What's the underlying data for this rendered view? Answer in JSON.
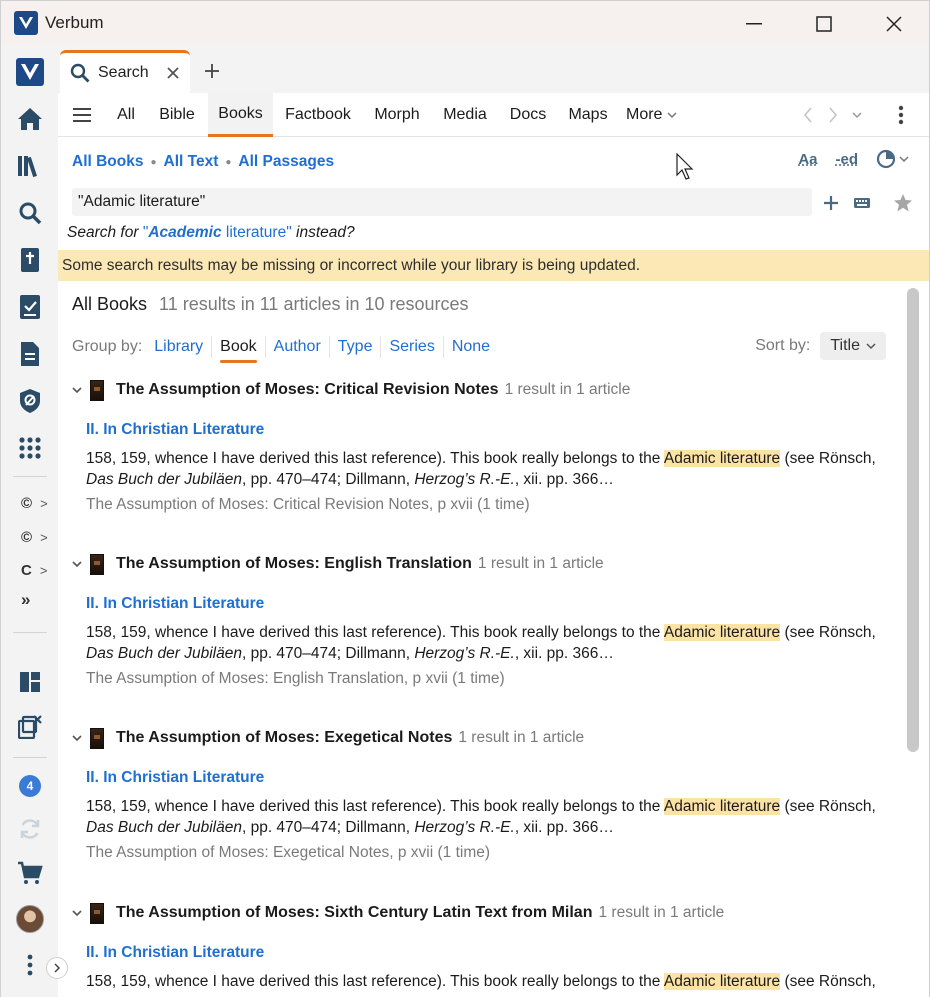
{
  "window": {
    "title": "Verbum",
    "controls": [
      "minimize",
      "maximize",
      "close"
    ]
  },
  "tab": {
    "label": "Search"
  },
  "nav": {
    "tabs": [
      {
        "label": "All"
      },
      {
        "label": "Bible"
      },
      {
        "label": "Books"
      },
      {
        "label": "Factbook"
      },
      {
        "label": "Morph"
      },
      {
        "label": "Media"
      },
      {
        "label": "Docs"
      },
      {
        "label": "Maps"
      },
      {
        "label": "More"
      }
    ],
    "active": "Books"
  },
  "scope": {
    "a": "All Books",
    "b": "All Text",
    "c": "All Passages"
  },
  "toolbar_icons": {
    "font": "Aa",
    "inflect": "-ed"
  },
  "search": {
    "value": "\"Adamic literature\""
  },
  "suggestion": {
    "prefix": "Search for",
    "quote_open": "\"",
    "bold_word": "Academic",
    "rest": " literature\"",
    "suffix": "instead?"
  },
  "warning": "Some search results may be missing or incorrect while your library is being updated.",
  "results": {
    "title": "All Books",
    "count": "11 results in 11 articles in 10 resources"
  },
  "group_by": {
    "label": "Group by:",
    "options": [
      "Library",
      "Book",
      "Author",
      "Type",
      "Series",
      "None"
    ],
    "active": "Book"
  },
  "sort_by": {
    "label": "Sort by:",
    "value": "Title"
  },
  "rail": {
    "small_items": [
      "©",
      "©",
      "C"
    ],
    "badge": "4"
  },
  "groups": [
    {
      "title": "The Assumption of Moses: Critical Revision Notes",
      "count": "1 result in 1 article",
      "article": "II. In Christian Literature",
      "pre": "158, 159, whence I have derived this last reference). This book really belongs to the ",
      "hit": "Adamic literature",
      "post1": " (see Rönsch,",
      "i1": "Das Buch der Jubiläen",
      "m1": ", pp. 470–474; Dillmann, ",
      "i2": "Herzog’s R.-E.",
      "m2": ", xii. pp. 366…",
      "source": "The Assumption of Moses: Critical Revision Notes, p xvii (1 time)"
    },
    {
      "title": "The Assumption of Moses: English Translation",
      "count": "1 result in 1 article",
      "article": "II. In Christian Literature",
      "pre": "158, 159, whence I have derived this last reference). This book really belongs to the ",
      "hit": "Adamic literature",
      "post1": " (see Rönsch,",
      "i1": "Das Buch der Jubiläen",
      "m1": ", pp. 470–474; Dillmann, ",
      "i2": "Herzog’s R.-E.",
      "m2": ", xii. pp. 366…",
      "source": "The Assumption of Moses: English Translation, p xvii (1 time)"
    },
    {
      "title": "The Assumption of Moses: Exegetical Notes",
      "count": "1 result in 1 article",
      "article": "II. In Christian Literature",
      "pre": "158, 159, whence I have derived this last reference). This book really belongs to the ",
      "hit": "Adamic literature",
      "post1": " (see Rönsch,",
      "i1": "Das Buch der Jubiläen",
      "m1": ", pp. 470–474; Dillmann, ",
      "i2": "Herzog’s R.-E.",
      "m2": ", xii. pp. 366…",
      "source": "The Assumption of Moses: Exegetical Notes, p xvii (1 time)"
    },
    {
      "title": "The Assumption of Moses: Sixth Century Latin Text from Milan",
      "count": "1 result in 1 article",
      "article": "II. In Christian Literature",
      "pre": "158, 159, whence I have derived this last reference). This book really belongs to the ",
      "hit": "Adamic literature",
      "post1": " (see Rönsch,",
      "i1": "",
      "m1": "",
      "i2": "",
      "m2": "",
      "source": ""
    }
  ],
  "colors": {
    "accent": "#e8751a",
    "link": "#1f6fd1",
    "highlight": "#fbe3a6",
    "warning_bg": "#fbe8b5"
  }
}
